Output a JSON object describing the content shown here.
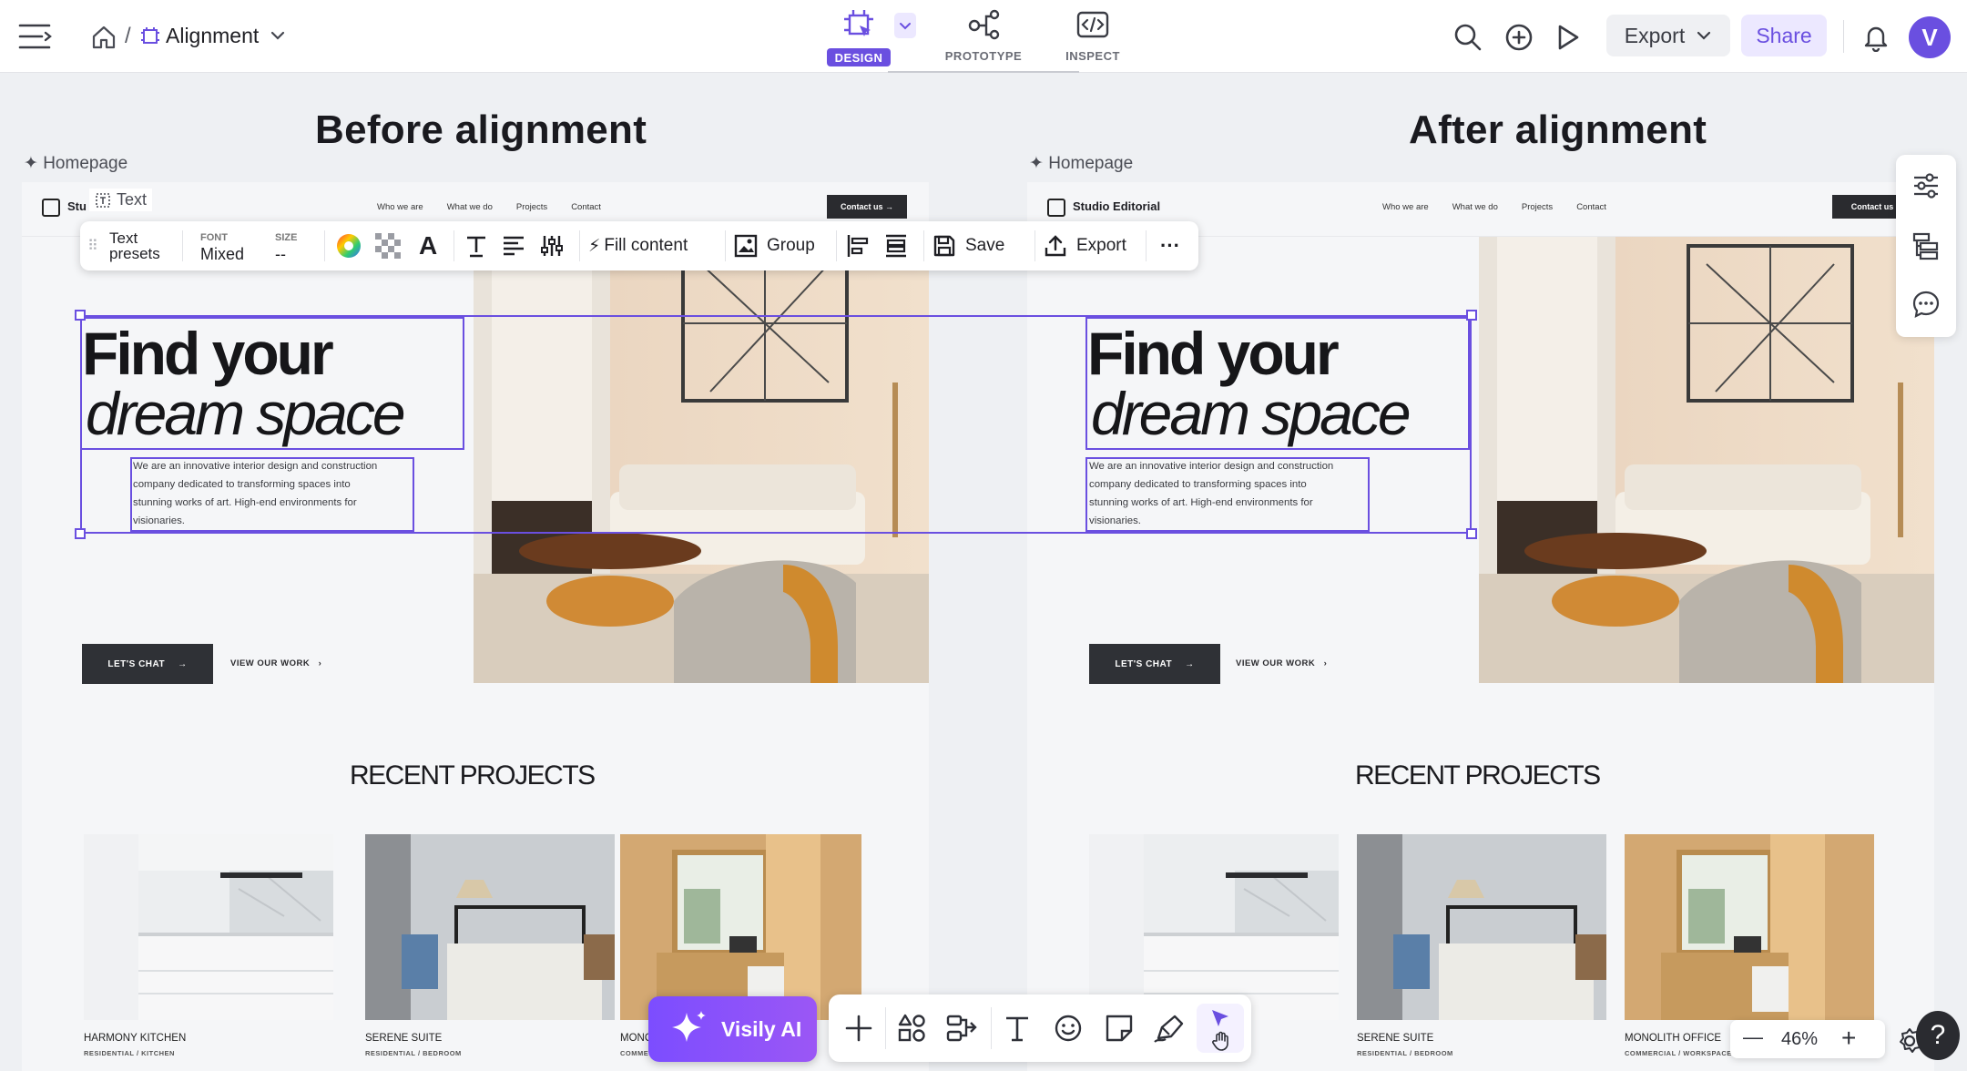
{
  "header": {
    "breadcrumb_sep": "/",
    "file_name": "Alignment",
    "tabs": [
      {
        "label": "DESIGN",
        "active": true
      },
      {
        "label": "PROTOTYPE",
        "active": false
      },
      {
        "label": "INSPECT",
        "active": false
      }
    ],
    "export_label": "Export",
    "share_label": "Share",
    "avatar_letter": "V"
  },
  "canvas": {
    "frames": [
      {
        "title": "Before alignment",
        "page_label": "Homepage"
      },
      {
        "title": "After alignment",
        "page_label": "Homepage"
      }
    ],
    "selection_tag": "Text"
  },
  "artboard": {
    "brand": "Studio Editorial",
    "brand_cut": "Stu",
    "nav_links": [
      "Who we are",
      "What we do",
      "Projects",
      "Contact"
    ],
    "cta": "Contact us",
    "hero_line1": "Find your",
    "hero_line2": "dream space",
    "paragraph_lines": [
      "We are an innovative interior design and construction",
      "company dedicated to transforming spaces into",
      "stunning works of art. High-end environments for",
      "visionaries."
    ],
    "btn_primary": "LET'S CHAT",
    "btn_secondary": "VIEW OUR WORK",
    "recent_title": "RECENT PROJECTS",
    "projects": [
      {
        "name": "HARMONY KITCHEN",
        "sub": "RESIDENTIAL / KITCHEN"
      },
      {
        "name": "SERENE SUITE",
        "sub": "RESIDENTIAL / BEDROOM"
      },
      {
        "name": "MONOLITH OFFICE",
        "sub": "COMMERCIAL / WORKSPACE"
      }
    ],
    "cut_name": "MONO",
    "cut_sub": "COMME"
  },
  "text_toolbar": {
    "presets_line1": "Text",
    "presets_line2": "presets",
    "font_label": "FONT",
    "font_value": "Mixed",
    "size_label": "SIZE",
    "size_value": "--",
    "fill_content": "Fill content",
    "group": "Group",
    "save": "Save",
    "export": "Export",
    "more": "···"
  },
  "bottom": {
    "ai_label": "Visily AI",
    "zoom_value": "46%",
    "zoom_minus": "—",
    "zoom_plus": "+",
    "help": "?"
  },
  "colors": {
    "accent": "#6a4fe0",
    "accent_light": "#ece8ff",
    "dark_button": "#2f3136"
  }
}
